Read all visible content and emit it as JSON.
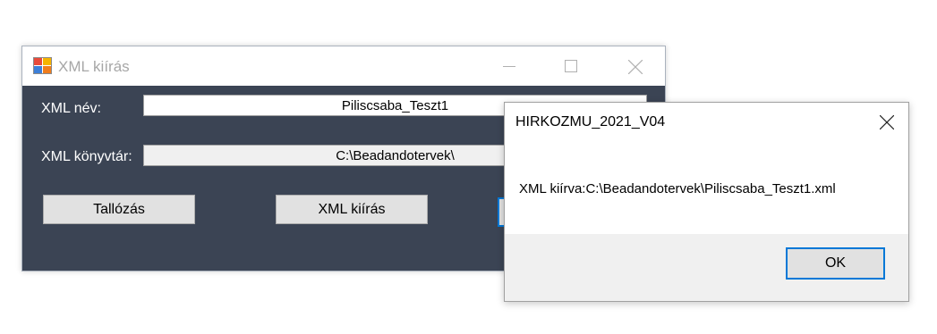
{
  "main_window": {
    "title": "XML kiírás",
    "name_label": "XML név:",
    "name_value": "Piliscsaba_Teszt1",
    "dir_label": "XML könyvtár:",
    "dir_value": "C:\\Beadandotervek\\",
    "browse_button": "Tallózás",
    "export_button": "XML kiírás"
  },
  "message_box": {
    "title": "HIRKOZMU_2021_V04",
    "message": "XML kiírva:C:\\Beadandotervek\\Piliscsaba_Teszt1.xml",
    "ok_button": "OK"
  },
  "colors": {
    "client_background": "#3b4454",
    "focus_border": "#0078d7",
    "button_face": "#e1e1e1"
  }
}
